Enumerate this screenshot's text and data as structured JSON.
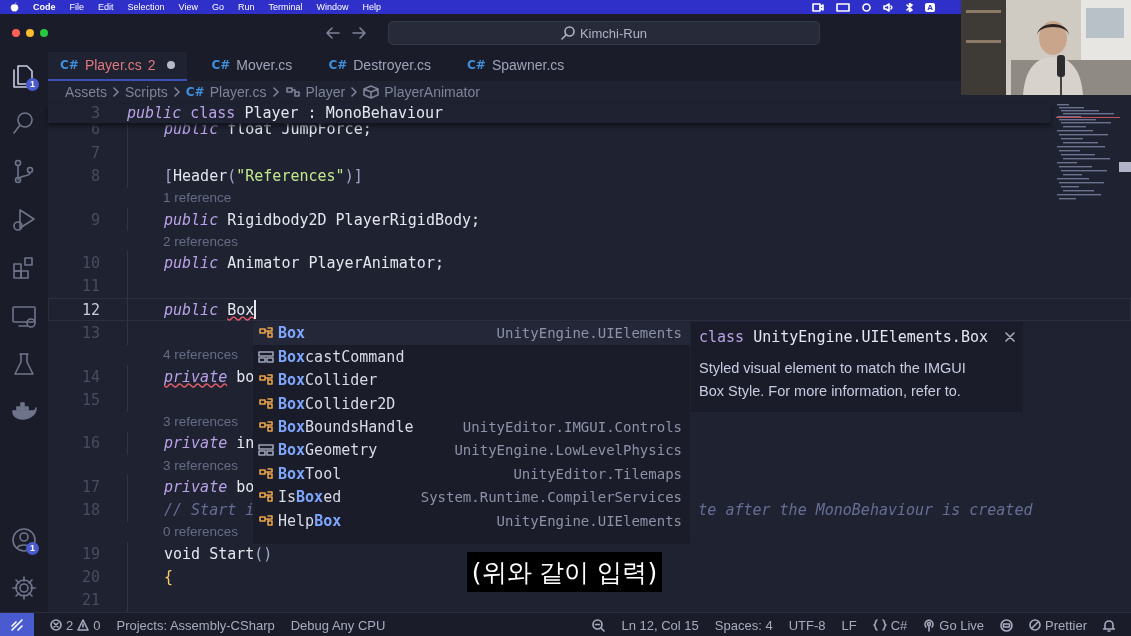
{
  "menu_bar": {
    "app_name": "Code",
    "items": [
      "File",
      "Edit",
      "Selection",
      "View",
      "Go",
      "Run",
      "Terminal",
      "Window",
      "Help"
    ],
    "input_source": "A"
  },
  "title_bar": {
    "search": "Kimchi-Run"
  },
  "activity_bar": {
    "top": [
      {
        "kind": "explorer",
        "selected": true,
        "badge": "1"
      },
      {
        "kind": "search",
        "selected": false
      },
      {
        "kind": "source-control",
        "selected": false
      },
      {
        "kind": "run-debug",
        "selected": false
      },
      {
        "kind": "extensions",
        "selected": false
      },
      {
        "kind": "remote",
        "selected": false
      },
      {
        "kind": "testing",
        "selected": false
      },
      {
        "kind": "docker",
        "selected": false
      }
    ],
    "bottom": [
      {
        "kind": "account",
        "selected": false,
        "badge": "1"
      },
      {
        "kind": "settings",
        "selected": false
      }
    ]
  },
  "tabs": [
    {
      "icon_text": "C#",
      "label": "Player.cs",
      "problems": "2",
      "modified": true,
      "selected": true
    },
    {
      "icon_text": "C#",
      "label": "Mover.cs",
      "modified": false,
      "selected": false
    },
    {
      "icon_text": "C#",
      "label": "Destroyer.cs",
      "modified": false,
      "selected": false
    },
    {
      "icon_text": "C#",
      "label": "Spawner.cs",
      "modified": false,
      "selected": false
    }
  ],
  "breadcrumb": [
    {
      "text": "Assets",
      "kind": "folder"
    },
    {
      "text": "Scripts",
      "kind": "folder"
    },
    {
      "text": "Player.cs",
      "kind": "csharp-file",
      "icon_text": "C#"
    },
    {
      "text": "Player",
      "kind": "class"
    },
    {
      "text": "PlayerAnimator",
      "kind": "field"
    }
  ],
  "editor": {
    "lines": [
      {
        "kind": "code",
        "number": "3",
        "sticky": true,
        "segments": [
          {
            "text": "public",
            "kind": "keyword"
          },
          {
            "text": " class",
            "kind": "storage"
          },
          {
            "text": " Player : MonoBehaviour",
            "kind": "plain"
          }
        ]
      },
      {
        "kind": "code",
        "number": "6",
        "segments": [
          {
            "text": "public",
            "kind": "keyword"
          },
          {
            "text": " float JumpForce;",
            "kind": "plain"
          }
        ]
      },
      {
        "kind": "code",
        "number": "7"
      },
      {
        "kind": "code",
        "number": "8",
        "segments": [
          {
            "text": "[",
            "kind": "punct"
          },
          {
            "text": "Header",
            "kind": "plain"
          },
          {
            "text": "(",
            "kind": "punct"
          },
          {
            "text": "\"References\"",
            "kind": "string"
          },
          {
            "text": ")]",
            "kind": "punct"
          }
        ]
      },
      {
        "kind": "lens",
        "text": "1 reference"
      },
      {
        "kind": "code",
        "number": "9",
        "segments": [
          {
            "text": "public",
            "kind": "keyword"
          },
          {
            "text": " Rigidbody2D PlayerRigidBody;",
            "kind": "plain"
          }
        ]
      },
      {
        "kind": "lens",
        "text": "2 references"
      },
      {
        "kind": "code",
        "number": "10",
        "segments": [
          {
            "text": "public",
            "kind": "keyword"
          },
          {
            "text": " Animator PlayerAnimator;",
            "kind": "plain"
          }
        ]
      },
      {
        "kind": "code",
        "number": "11"
      },
      {
        "kind": "code",
        "number": "12",
        "current": true,
        "cursor": true,
        "segments": [
          {
            "text": "public ",
            "kind": "keyword"
          },
          {
            "text": "Box",
            "kind": "plain",
            "error": true
          }
        ]
      },
      {
        "kind": "code",
        "number": "13"
      },
      {
        "kind": "lens",
        "text": "4 references"
      },
      {
        "kind": "code",
        "number": "14",
        "segments": [
          {
            "text": "private",
            "kind": "keyword",
            "error": true
          },
          {
            "text": " bo",
            "kind": "plain"
          }
        ]
      },
      {
        "kind": "code",
        "number": "15"
      },
      {
        "kind": "lens",
        "text": "3 references"
      },
      {
        "kind": "code",
        "number": "16",
        "segments": [
          {
            "text": "private",
            "kind": "keyword"
          },
          {
            "text": " in",
            "kind": "plain"
          }
        ]
      },
      {
        "kind": "lens",
        "text": "3 references"
      },
      {
        "kind": "code",
        "number": "17",
        "segments": [
          {
            "text": "private",
            "kind": "keyword"
          },
          {
            "text": " bo",
            "kind": "plain"
          }
        ]
      },
      {
        "kind": "code",
        "number": "18",
        "segments": [
          {
            "text": "// Start i",
            "kind": "comment"
          },
          {
            "text": "te after the MonoBehaviour is created",
            "kind": "comment-tail"
          }
        ]
      },
      {
        "kind": "lens",
        "text": "0 references"
      },
      {
        "kind": "code",
        "number": "19",
        "segments": [
          {
            "text": "void ",
            "kind": "plain"
          },
          {
            "text": "Start",
            "kind": "plain"
          },
          {
            "text": "()",
            "kind": "punct"
          }
        ]
      },
      {
        "kind": "code",
        "number": "20",
        "segments": [
          {
            "text": "{",
            "kind": "bracket"
          }
        ]
      },
      {
        "kind": "code",
        "number": "21"
      }
    ]
  },
  "suggestions": [
    {
      "kind": "class",
      "parts": [
        {
          "text": "Box",
          "match": true
        }
      ],
      "detail": "UnityEngine.UIElements",
      "selected": true
    },
    {
      "kind": "struct",
      "parts": [
        {
          "text": "Box",
          "match": true
        },
        {
          "text": "castCommand",
          "match": false
        }
      ],
      "selected": false
    },
    {
      "kind": "class",
      "parts": [
        {
          "text": "Box",
          "match": true
        },
        {
          "text": "Collider",
          "match": false
        }
      ],
      "selected": false
    },
    {
      "kind": "class",
      "parts": [
        {
          "text": "Box",
          "match": true
        },
        {
          "text": "Collider2D",
          "match": false
        }
      ],
      "selected": false
    },
    {
      "kind": "class",
      "parts": [
        {
          "text": "Box",
          "match": true
        },
        {
          "text": "BoundsHandle",
          "match": false
        }
      ],
      "detail": "UnityEditor.IMGUI.Controls",
      "selected": false
    },
    {
      "kind": "struct",
      "parts": [
        {
          "text": "Box",
          "match": true
        },
        {
          "text": "Geometry",
          "match": false
        }
      ],
      "detail": "UnityEngine.LowLevelPhysics",
      "selected": false
    },
    {
      "kind": "class",
      "parts": [
        {
          "text": "Box",
          "match": true
        },
        {
          "text": "Tool",
          "match": false
        }
      ],
      "detail": "UnityEditor.Tilemaps",
      "selected": false
    },
    {
      "kind": "class",
      "parts": [
        {
          "text": "Is",
          "match": false
        },
        {
          "text": "Box",
          "match": true
        },
        {
          "text": "ed",
          "match": false
        }
      ],
      "detail": "System.Runtime.CompilerServices",
      "selected": false
    },
    {
      "kind": "class",
      "parts": [
        {
          "text": "Help",
          "match": false
        },
        {
          "text": "Box",
          "match": true
        }
      ],
      "detail": "UnityEngine.UIElements",
      "selected": false
    }
  ],
  "docs": {
    "keyword": "class",
    "signature": "UnityEngine.UIElements.Box",
    "description": "Styled visual element to match the IMGUI Box Style. For more information, refer to."
  },
  "subtitle": "(위와 같이 입력)",
  "status_bar": {
    "errors": "2",
    "warnings": "0",
    "left": [
      "Projects: Assembly-CSharp",
      "Debug Any CPU"
    ],
    "position": "Ln 12, Col 15",
    "indent": "Spaces: 4",
    "encoding": "UTF-8",
    "eol": "LF",
    "language": "C#",
    "go_live": "Go Live",
    "prettier": "Prettier"
  }
}
